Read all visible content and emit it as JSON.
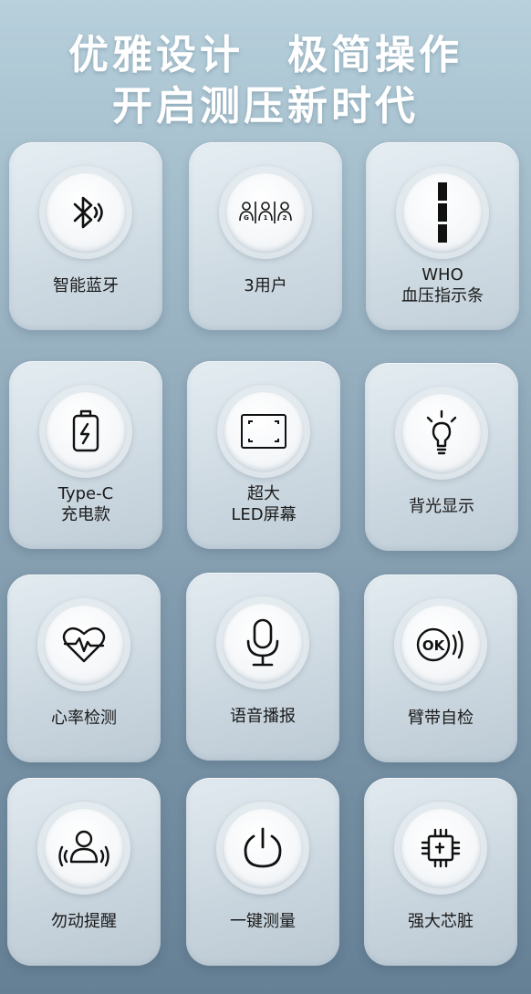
{
  "headline": {
    "line1": "优雅设计　极简操作",
    "line2": "开启测压新时代"
  },
  "features": [
    {
      "icon": "bluetooth-icon",
      "lines": [
        "智能蓝牙"
      ]
    },
    {
      "icon": "users-icon",
      "lines": [
        "3用户"
      ]
    },
    {
      "icon": "indicator-bar-icon",
      "lines": [
        "WHO",
        "血压指示条"
      ]
    },
    {
      "icon": "battery-charge-icon",
      "lines": [
        "Type-C",
        "充电款"
      ]
    },
    {
      "icon": "screen-icon",
      "lines": [
        "超大",
        "LED屏幕"
      ]
    },
    {
      "icon": "lightbulb-icon",
      "lines": [
        "背光显示"
      ]
    },
    {
      "icon": "heart-rate-icon",
      "lines": [
        "心率检测"
      ]
    },
    {
      "icon": "microphone-icon",
      "lines": [
        "语音播报"
      ]
    },
    {
      "icon": "ok-sound-icon",
      "lines": [
        "臂带自检"
      ]
    },
    {
      "icon": "person-motion-icon",
      "lines": [
        "勿动提醒"
      ]
    },
    {
      "icon": "power-icon",
      "lines": [
        "一键测量"
      ]
    },
    {
      "icon": "chip-icon",
      "lines": [
        "强大芯脏"
      ]
    }
  ]
}
